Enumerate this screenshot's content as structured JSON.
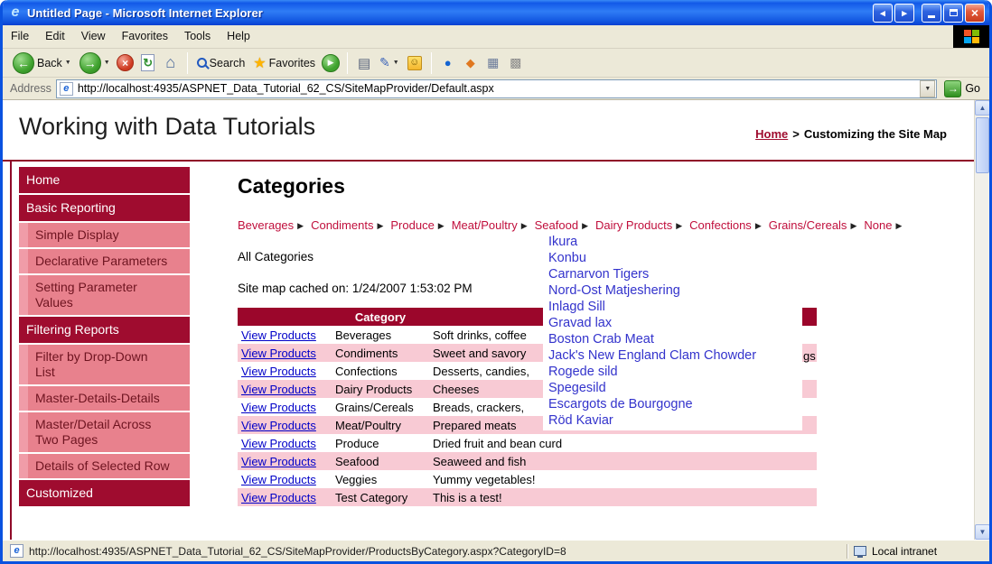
{
  "window": {
    "title": "Untitled Page - Microsoft Internet Explorer"
  },
  "menubar": {
    "items": [
      "File",
      "Edit",
      "View",
      "Favorites",
      "Tools",
      "Help"
    ]
  },
  "toolbar": {
    "back_label": "Back",
    "search_label": "Search",
    "favorites_label": "Favorites"
  },
  "address": {
    "label": "Address",
    "url": "http://localhost:4935/ASPNET_Data_Tutorial_62_CS/SiteMapProvider/Default.aspx",
    "go_label": "Go"
  },
  "header": {
    "title": "Working with Data Tutorials",
    "breadcrumb": {
      "home": "Home",
      "separator": ">",
      "current": "Customizing the Site Map"
    }
  },
  "sidebar": {
    "items": [
      {
        "label": "Home",
        "level": 0
      },
      {
        "label": "Basic Reporting",
        "level": 0
      },
      {
        "label": "Simple Display",
        "level": 1
      },
      {
        "label": "Declarative Parameters",
        "level": 1
      },
      {
        "label": "Setting Parameter Values",
        "level": 1
      },
      {
        "label": "Filtering Reports",
        "level": 0
      },
      {
        "label": "Filter by Drop-Down List",
        "level": 1
      },
      {
        "label": "Master-Details-Details",
        "level": 1
      },
      {
        "label": "Master/Detail Across Two Pages",
        "level": 1
      },
      {
        "label": "Details of Selected Row",
        "level": 1
      },
      {
        "label": "Customized",
        "level": 0
      }
    ]
  },
  "main": {
    "heading": "Categories",
    "menu": {
      "items": [
        "Beverages",
        "Condiments",
        "Produce",
        "Meat/Poultry",
        "Seafood",
        "Dairy Products",
        "Confections",
        "Grains/Cereals",
        "None"
      ]
    },
    "flyout": {
      "items": [
        "Ikura",
        "Konbu",
        "Carnarvon Tigers",
        "Nord-Ost Matjeshering",
        "Inlagd Sill",
        "Gravad lax",
        "Boston Crab Meat",
        "Jack's New England Clam Chowder",
        "Rogede sild",
        "Spegesild",
        "Escargots de Bourgogne",
        "Röd Kaviar"
      ]
    },
    "all_categories_label": "All Categories",
    "cache_text": "Site map cached on: 1/24/2007 1:53:02 PM",
    "table": {
      "header": "Category",
      "link_label": "View Products",
      "tail_fragment": "gs",
      "rows": [
        {
          "category": "Beverages",
          "desc": "Soft drinks, coffee"
        },
        {
          "category": "Condiments",
          "desc": "Sweet and savory"
        },
        {
          "category": "Confections",
          "desc": "Desserts, candies,"
        },
        {
          "category": "Dairy Products",
          "desc": "Cheeses"
        },
        {
          "category": "Grains/Cereals",
          "desc": "Breads, crackers,"
        },
        {
          "category": "Meat/Poultry",
          "desc": "Prepared meats"
        },
        {
          "category": "Produce",
          "desc": "Dried fruit and bean curd"
        },
        {
          "category": "Seafood",
          "desc": "Seaweed and fish"
        },
        {
          "category": "Veggies",
          "desc": "Yummy vegetables!"
        },
        {
          "category": "Test Category",
          "desc": "This is a test!"
        }
      ]
    }
  },
  "statusbar": {
    "url": "http://localhost:4935/ASPNET_Data_Tutorial_62_CS/SiteMapProvider/ProductsByCategory.aspx?CategoryID=8",
    "zone": "Local intranet"
  },
  "icons": {
    "ie_e": "e",
    "back_arrow": "←",
    "forward_arrow": "→",
    "dropdown_caret": "▼",
    "stop_glyph": "×",
    "refresh_glyph": "↻",
    "home_glyph": "⌂",
    "star_glyph": "★",
    "media_glyph": "▶",
    "print_glyph": "▤",
    "edit_glyph": "✎",
    "messenger_glyph": "☺",
    "tool1_glyph": "●",
    "tool2_glyph": "◆",
    "tool3_glyph": "▦",
    "tool4_glyph": "▩",
    "menu_arrow": "▶",
    "go_arrow": "→",
    "close_glyph": "×",
    "pair_left": "◂",
    "pair_right": "▸",
    "scroll_up": "▲",
    "scroll_down": "▼"
  }
}
